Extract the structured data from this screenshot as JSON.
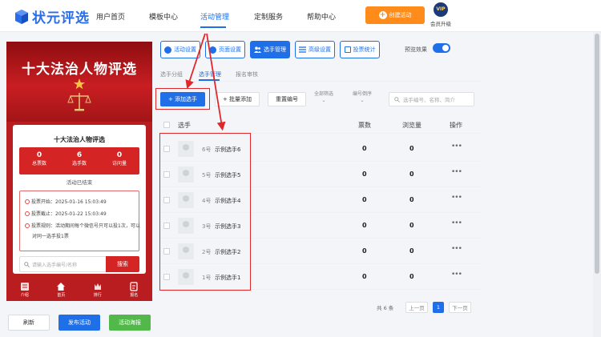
{
  "brand": {
    "name": "状元评选",
    "colors": {
      "primary": "#1f6fe8",
      "accent_orange": "#ff8b1a",
      "preview_red": "#ba1d1f",
      "highlight_red": "#e0282c",
      "green": "#52b84a"
    }
  },
  "nav": {
    "items": [
      {
        "label": "用户首页"
      },
      {
        "label": "模板中心"
      },
      {
        "label": "活动管理",
        "active": true
      },
      {
        "label": "定制服务"
      },
      {
        "label": "帮助中心"
      }
    ],
    "create_label": "创建活动",
    "vip_badge": "VIP",
    "vip_label": "会员升级"
  },
  "preview": {
    "banner_title": "十大法治人物评选",
    "card_title": "十大法治人物评选",
    "stats": [
      {
        "value": "0",
        "label": "总票数"
      },
      {
        "value": "6",
        "label": "选手数"
      },
      {
        "value": "0",
        "label": "访问量"
      }
    ],
    "status": "活动已结束",
    "vote_start": "投票开始：2025-01-16 15:03:49",
    "vote_end": "投票截止：2025-01-22 15:03:49",
    "vote_rule_1": "投票规则：活动期间每个微信号只可以投1次，可以",
    "vote_rule_2": "对同一选手投1票",
    "search_placeholder": "请输入选手编号/名称",
    "search_button": "搜索",
    "bottom_tabs": [
      {
        "label": "介绍",
        "icon": "intro-icon"
      },
      {
        "label": "首页",
        "icon": "home-icon"
      },
      {
        "label": "排行",
        "icon": "rank-icon"
      },
      {
        "label": "报名",
        "icon": "signup-icon"
      }
    ]
  },
  "left_actions": {
    "refresh": "刷新",
    "publish": "发布活动",
    "poster": "活动海报"
  },
  "toolbar": {
    "buttons": [
      {
        "label": "活动设置",
        "icon": "settings-icon"
      },
      {
        "label": "页面设置",
        "icon": "page-settings-icon"
      },
      {
        "label": "选手管理",
        "icon": "users-icon",
        "active": true
      },
      {
        "label": "高级设置",
        "icon": "advanced-icon"
      },
      {
        "label": "投票统计",
        "icon": "stats-icon"
      }
    ],
    "preview_label": "预览效果",
    "preview_on": true
  },
  "subtabs": [
    {
      "label": "选手分组"
    },
    {
      "label": "选手管理",
      "active": true
    },
    {
      "label": "报名审核"
    }
  ],
  "actions": {
    "add": "+ 添加选手",
    "batch": "+ 批量添加",
    "reset": "重置编号",
    "filter_all": "全部筛选",
    "sort_label": "编号倒序",
    "search_placeholder": "选手编号、名称、简介"
  },
  "table": {
    "columns": {
      "player": "选手",
      "votes": "票数",
      "views": "浏览量",
      "ops": "操作"
    },
    "rows": [
      {
        "num": "6号",
        "name": "示例选手6",
        "votes": "0",
        "views": "0",
        "ops": "•••"
      },
      {
        "num": "5号",
        "name": "示例选手5",
        "votes": "0",
        "views": "0",
        "ops": "•••"
      },
      {
        "num": "4号",
        "name": "示例选手4",
        "votes": "0",
        "views": "0",
        "ops": "•••"
      },
      {
        "num": "3号",
        "name": "示例选手3",
        "votes": "0",
        "views": "0",
        "ops": "•••"
      },
      {
        "num": "2号",
        "name": "示例选手2",
        "votes": "0",
        "views": "0",
        "ops": "•••"
      },
      {
        "num": "1号",
        "name": "示例选手1",
        "votes": "0",
        "views": "0",
        "ops": "•••"
      }
    ]
  },
  "pagination": {
    "total": "共 6 条",
    "prev": "上一页",
    "current": "1",
    "next": "下一页"
  }
}
